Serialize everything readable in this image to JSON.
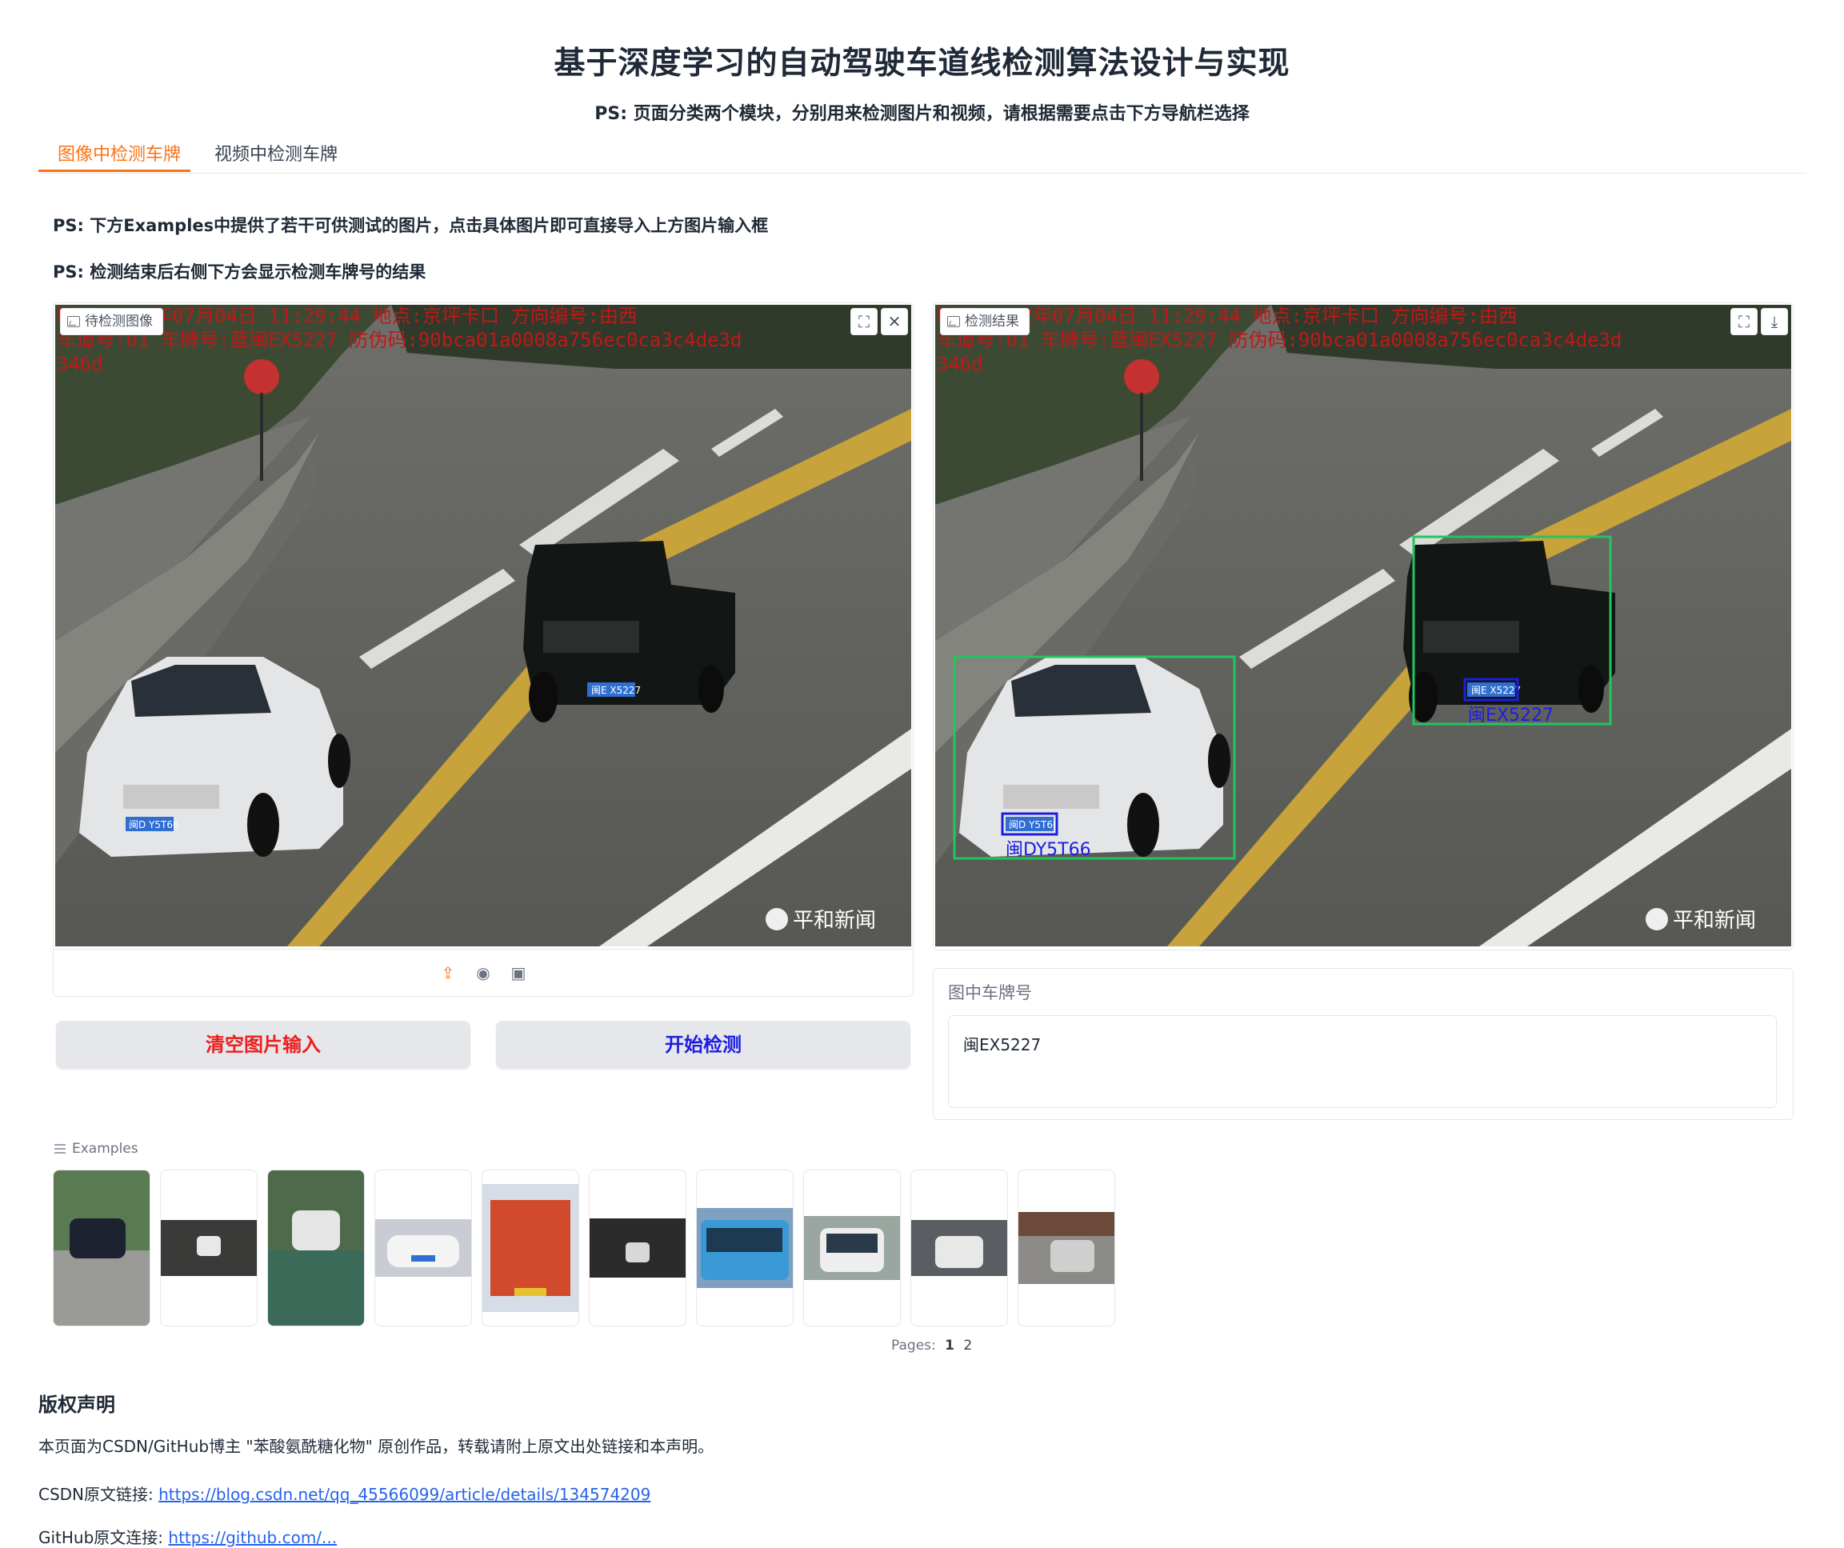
{
  "page": {
    "title": "基于深度学习的自动驾驶车道线检测算法设计与实现",
    "subtitle": "PS: 页面分类两个模块，分别用来检测图片和视频，请根据需要点击下方导航栏选择"
  },
  "tabs": [
    {
      "label": "图像中检测车牌",
      "active": true
    },
    {
      "label": "视频中检测车牌",
      "active": false
    }
  ],
  "notes": {
    "examples_hint": "PS: 下方Examples中提供了若干可供测试的图片，点击具体图片即可直接导入上方图片输入框",
    "result_hint": "PS: 检测结束后右侧下方会显示检测车牌号的结果"
  },
  "input_image": {
    "label": "待检测图像",
    "overlay_line1": "时间:2012年07月04日  11:29:44  地点:京坪卡口  方向编号:由西",
    "overlay_line2": "车道号:01  车牌号:蓝闽EX5227  防伪码:90bca01a0008a756ec0ca3c4de3d",
    "overlay_line3": "346d",
    "watermark": "平和新闻",
    "plate_front_car": "闽D Y5T66",
    "plate_truck": "闽E X5227",
    "icons": [
      "image-icon",
      "fullscreen-icon",
      "close-icon",
      "upload-icon",
      "webcam-icon",
      "clipboard-icon"
    ]
  },
  "output_image": {
    "label": "检测结果",
    "overlay_line1": "时间:2012年07月04日  11:29:44  地点:京坪卡口  方向编号:由西",
    "overlay_line2": "车道号:01  车牌号:蓝闽EX5227  防伪码:90bca01a0008a756ec0ca3c4de3d",
    "overlay_line3": "346d",
    "watermark": "平和新闻",
    "plate_front_car": "闽D Y5T66",
    "plate_truck": "闽E X5227",
    "detected_truck_text": "闽EX5227",
    "detected_car_text": "闽DY5T66",
    "box_color": "#22c55e",
    "plate_box_color": "#1d1de0",
    "icons": [
      "image-icon",
      "fullscreen-icon",
      "download-icon"
    ]
  },
  "buttons": {
    "clear_label": "清空图片输入",
    "clear_color": "#ef1c1c",
    "detect_label": "开始检测",
    "detect_color": "#1d1de0"
  },
  "plate_result": {
    "label": "图中车牌号",
    "value": "闽EX5227"
  },
  "examples": {
    "label": "Examples",
    "pages_label": "Pages:",
    "pages": [
      "1",
      "2"
    ],
    "current_page": "1",
    "thumbnail_count": 10
  },
  "copyright": {
    "heading": "版权声明",
    "text": "本页面为CSDN/GitHub博主 \"苯酸氨酰糖化物\" 原创作品，转载请附上原文出处链接和本声明。",
    "csdn_prefix": "CSDN原文链接:",
    "csdn_url": "https://blog.csdn.net/qq_45566099/article/details/134574209",
    "github_prefix": "GitHub原文连接:",
    "github_url": "https://github.com/..."
  },
  "colors": {
    "accent": "#f97316",
    "link": "#2563eb",
    "panel_border": "#e5e7eb",
    "button_bg": "#e5e7eb"
  }
}
